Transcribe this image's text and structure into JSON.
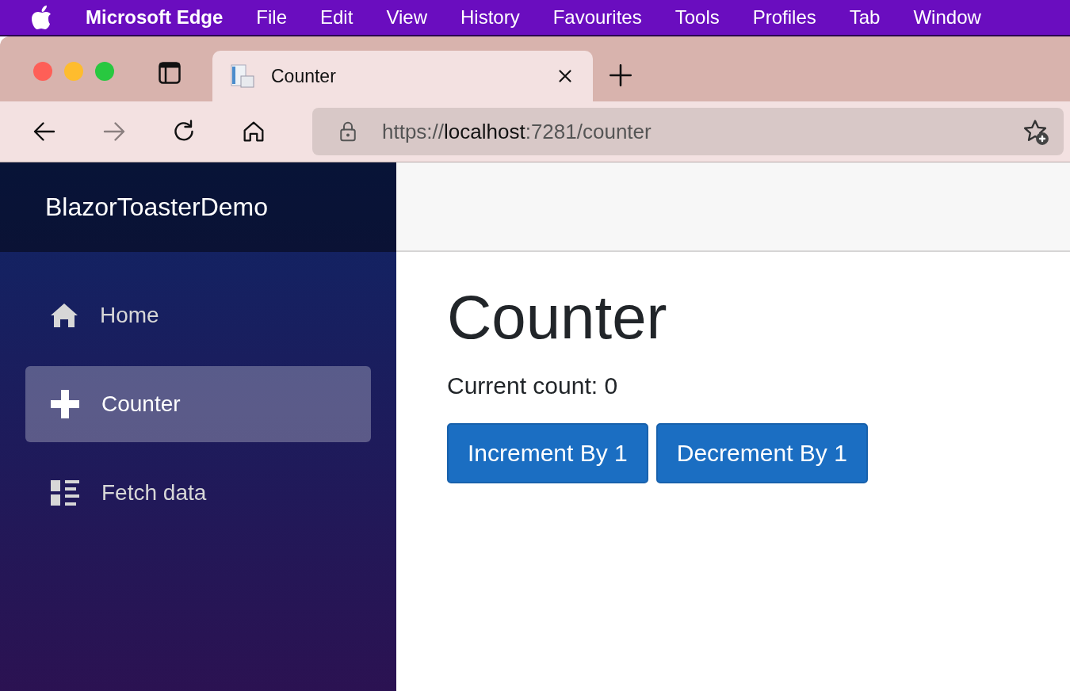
{
  "menu_bar": [
    {
      "kind": "app",
      "label": "Microsoft Edge"
    },
    {
      "kind": "menu",
      "label": "File"
    },
    {
      "kind": "menu",
      "label": "Edit"
    },
    {
      "kind": "menu",
      "label": "View"
    },
    {
      "kind": "menu",
      "label": "History"
    },
    {
      "kind": "menu",
      "label": "Favourites"
    },
    {
      "kind": "menu",
      "label": "Tools"
    },
    {
      "kind": "menu",
      "label": "Profiles"
    },
    {
      "kind": "menu",
      "label": "Tab"
    },
    {
      "kind": "menu",
      "label": "Window"
    }
  ],
  "tabs": [
    {
      "title": "Counter",
      "selected": true
    }
  ],
  "address_bar": {
    "scheme": "https://",
    "host": "localhost",
    "rest": ":7281/counter"
  },
  "forward_disabled": true,
  "sidebar": {
    "brand": "BlazorToasterDemo",
    "items": [
      {
        "kind": "home",
        "label": "Home",
        "selected": false
      },
      {
        "kind": "plus",
        "label": "Counter",
        "selected": true
      },
      {
        "kind": "list",
        "label": "Fetch data",
        "selected": false
      }
    ]
  },
  "content": {
    "heading": "Counter",
    "count_text": "Current count: 0",
    "buttons": [
      "Increment By 1",
      "Decrement By 1"
    ]
  }
}
